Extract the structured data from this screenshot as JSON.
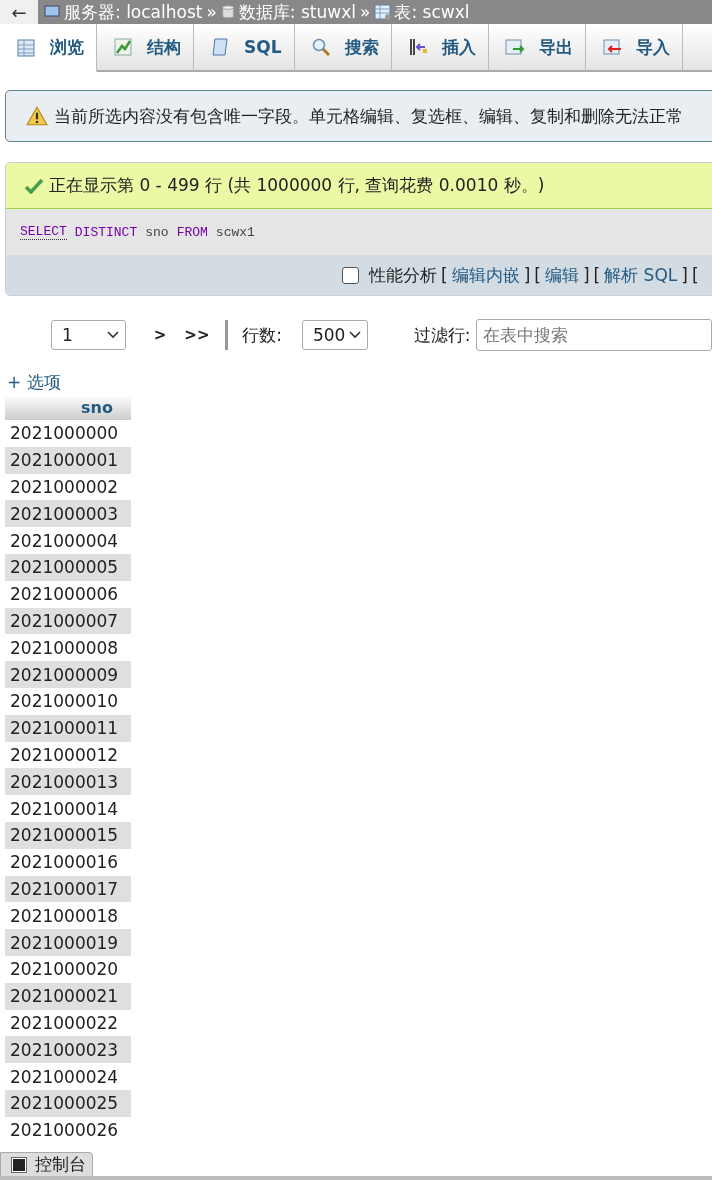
{
  "back": "←",
  "breadcrumb": [
    {
      "kind": "server",
      "label": "服务器: localhost"
    },
    {
      "kind": "sep",
      "label": "»"
    },
    {
      "kind": "database",
      "label": "数据库: stuwxl"
    },
    {
      "kind": "sep",
      "label": "»"
    },
    {
      "kind": "table",
      "label": "表: scwxl"
    }
  ],
  "tabs": [
    {
      "kind": "browse",
      "label": "浏览",
      "selected": true
    },
    {
      "kind": "structure",
      "label": "结构",
      "selected": false
    },
    {
      "kind": "sql",
      "label": "SQL",
      "selected": false
    },
    {
      "kind": "search",
      "label": "搜索",
      "selected": false
    },
    {
      "kind": "insert",
      "label": "插入",
      "selected": false
    },
    {
      "kind": "export",
      "label": "导出",
      "selected": false
    },
    {
      "kind": "import",
      "label": "导入",
      "selected": false
    }
  ],
  "notice": "当前所选内容没有包含唯一字段。单元格编辑、复选框、编辑、复制和删除无法正常",
  "success": "正在显示第 0 - 499 行 (共 1000000 行, 查询花费 0.0010 秒。)",
  "sql": [
    {
      "kind": "link",
      "text": "SELECT"
    },
    {
      "kind": "keyword",
      "text": "DISTINCT"
    },
    {
      "kind": "plain",
      "text": "sno"
    },
    {
      "kind": "keyword",
      "text": "FROM"
    },
    {
      "kind": "plain",
      "text": "scwx1"
    }
  ],
  "profiling": {
    "label": "性能分析",
    "checked": false
  },
  "actions": [
    {
      "open": "[",
      "label": "编辑内嵌",
      "close": "]"
    },
    {
      "open": "[",
      "label": "编辑",
      "close": "]"
    },
    {
      "open": "[",
      "label": "解析 SQL",
      "close": "]"
    },
    {
      "open": "["
    }
  ],
  "pagination": {
    "page": "1",
    "next": ">",
    "last": ">>",
    "rows_label": "行数:",
    "rows": "500",
    "filter_label": "过滤行:",
    "placeholder": "在表中搜索"
  },
  "options": "+ 选项",
  "column": "sno",
  "rows": [
    "2021000000",
    "2021000001",
    "2021000002",
    "2021000003",
    "2021000004",
    "2021000005",
    "2021000006",
    "2021000007",
    "2021000008",
    "2021000009",
    "2021000010",
    "2021000011",
    "2021000012",
    "2021000013",
    "2021000014",
    "2021000015",
    "2021000016",
    "2021000017",
    "2021000018",
    "2021000019",
    "2021000020",
    "2021000021",
    "2021000022",
    "2021000023",
    "2021000024",
    "2021000025",
    "2021000026"
  ],
  "console": "控制台"
}
